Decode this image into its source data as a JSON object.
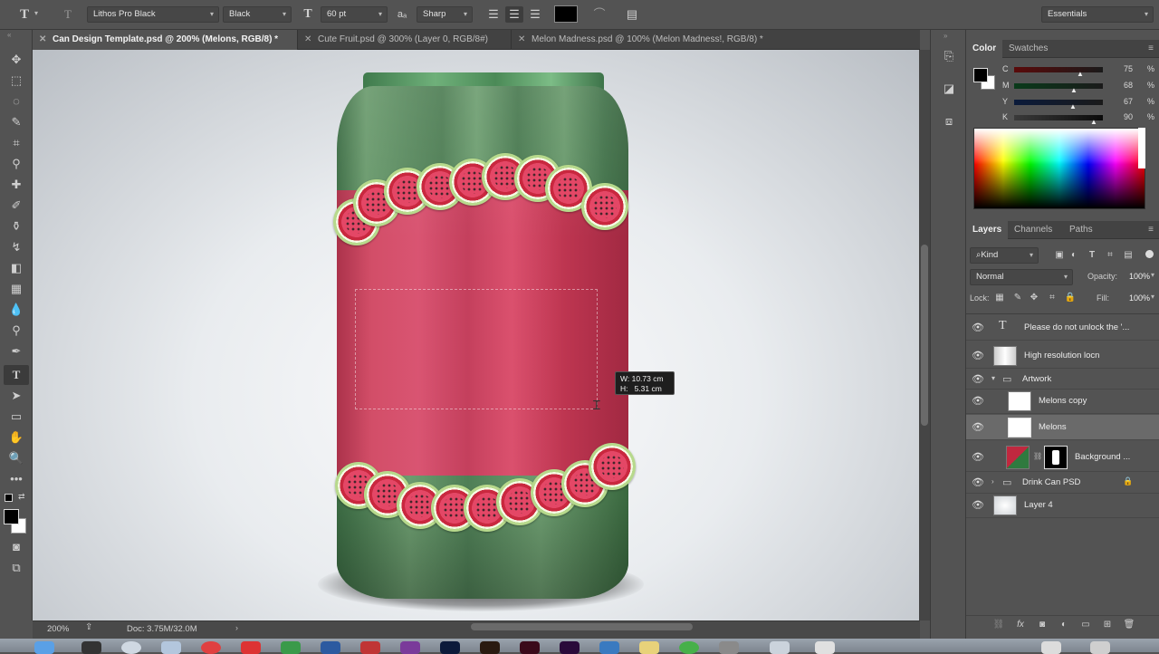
{
  "options_bar": {
    "font_family": "Lithos Pro Black",
    "font_style": "Black",
    "font_size": "60 pt",
    "aa_glyph": "a",
    "antialias": "Sharp",
    "text_color": "#000000",
    "workspace": "Essentials"
  },
  "tabs": [
    {
      "label": "Can Design Template.psd @ 200% (Melons, RGB/8) *",
      "active": true
    },
    {
      "label": "Cute Fruit.psd @ 300% (Layer 0, RGB/8#)",
      "active": false
    },
    {
      "label": "Melon Madness.psd @ 100% (Melon Madness!, RGB/8) *",
      "active": false
    }
  ],
  "status_bar": {
    "zoom": "200%",
    "doc_size": "Doc: 3.75M/32.0M"
  },
  "size_readout": {
    "width": "W: 10.73 cm",
    "height": "H:   5.31 cm"
  },
  "color_panel": {
    "tabs": [
      "Color",
      "Swatches"
    ],
    "sliders": [
      {
        "label": "C",
        "value": "75",
        "unit": "%"
      },
      {
        "label": "M",
        "value": "68",
        "unit": "%"
      },
      {
        "label": "Y",
        "value": "67",
        "unit": "%"
      },
      {
        "label": "K",
        "value": "90",
        "unit": "%"
      }
    ],
    "foreground": "#000000",
    "background": "#ffffff"
  },
  "layers_panel": {
    "tabs": [
      "Layers",
      "Channels",
      "Paths"
    ],
    "filter_kind": "Kind",
    "blend_mode": "Normal",
    "opacity_label": "Opacity:",
    "opacity": "100%",
    "lock_label": "Lock:",
    "fill_label": "Fill:",
    "fill": "100%",
    "layers": [
      {
        "name": "Please do not unlock the '...",
        "type": "text",
        "selected": false
      },
      {
        "name": "High resolution locn",
        "type": "smart",
        "selected": false
      },
      {
        "name": "Artwork",
        "type": "group-open",
        "selected": false
      },
      {
        "name": "Melons copy",
        "type": "pixel",
        "selected": false
      },
      {
        "name": "Melons",
        "type": "pixel",
        "selected": true
      },
      {
        "name": "Background ...",
        "type": "masked",
        "selected": false
      },
      {
        "name": "Drink Can PSD",
        "type": "group-closed",
        "selected": false
      },
      {
        "name": "Layer 4",
        "type": "pixel",
        "selected": false
      }
    ]
  },
  "icons": {
    "type_tool": "type-icon",
    "move_tool": "move-icon"
  }
}
